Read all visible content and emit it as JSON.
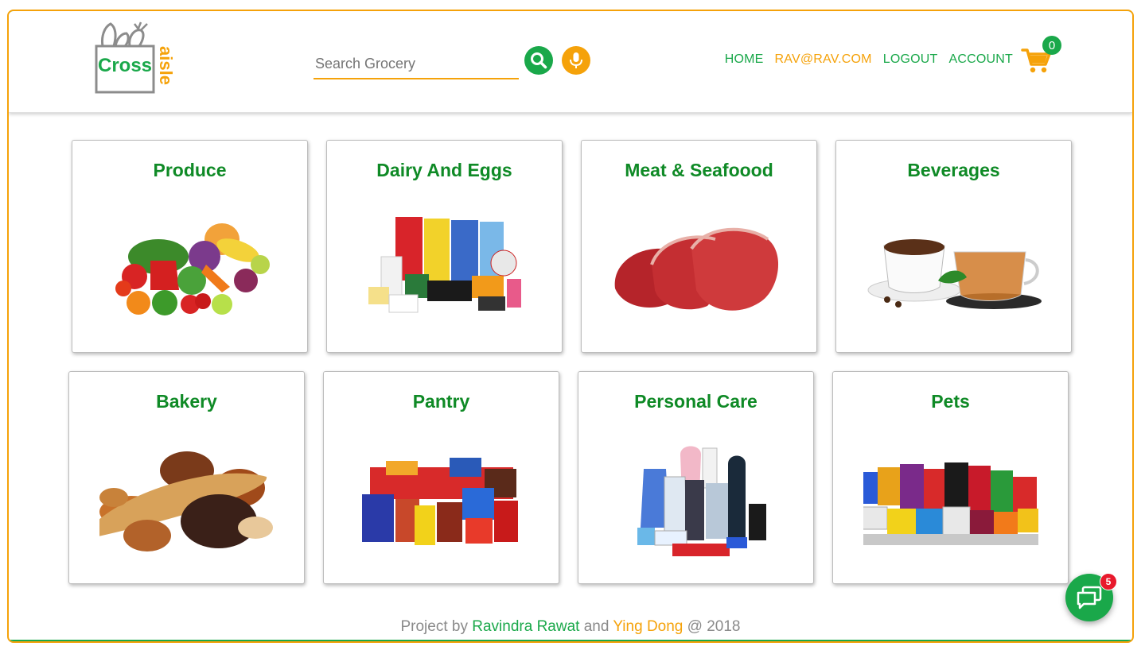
{
  "header": {
    "logo": {
      "word": "Cross",
      "side_word": "aisle"
    },
    "search": {
      "placeholder": "Search Grocery",
      "value": ""
    },
    "search_icon": "search-icon",
    "mic_icon": "microphone-icon",
    "nav": {
      "home": "HOME",
      "user": "RAV@RAV.COM",
      "logout": "LOGOUT",
      "account": "ACCOUNT"
    },
    "cart": {
      "icon": "cart-icon",
      "count": "0"
    }
  },
  "categories": [
    {
      "name": "Produce",
      "image": "produce-image"
    },
    {
      "name": "Dairy And Eggs",
      "image": "dairy-image"
    },
    {
      "name": "Meat & Seafoood",
      "image": "meat-image"
    },
    {
      "name": "Beverages",
      "image": "beverages-image"
    },
    {
      "name": "Bakery",
      "image": "bakery-image"
    },
    {
      "name": "Pantry",
      "image": "pantry-image"
    },
    {
      "name": "Personal Care",
      "image": "personal-care-image"
    },
    {
      "name": "Pets",
      "image": "pets-image"
    }
  ],
  "footer": {
    "prefix": "Project by",
    "author1": "Ravindra Rawat",
    "and": "and",
    "author2": "Ying Dong",
    "suffix": "@ 2018"
  },
  "chat": {
    "icon": "chat-icon",
    "badge": "5"
  },
  "colors": {
    "green": "#1aa84a",
    "title_green": "#0f8a26",
    "orange": "#f5a20a",
    "badge_red": "#e8192c"
  }
}
